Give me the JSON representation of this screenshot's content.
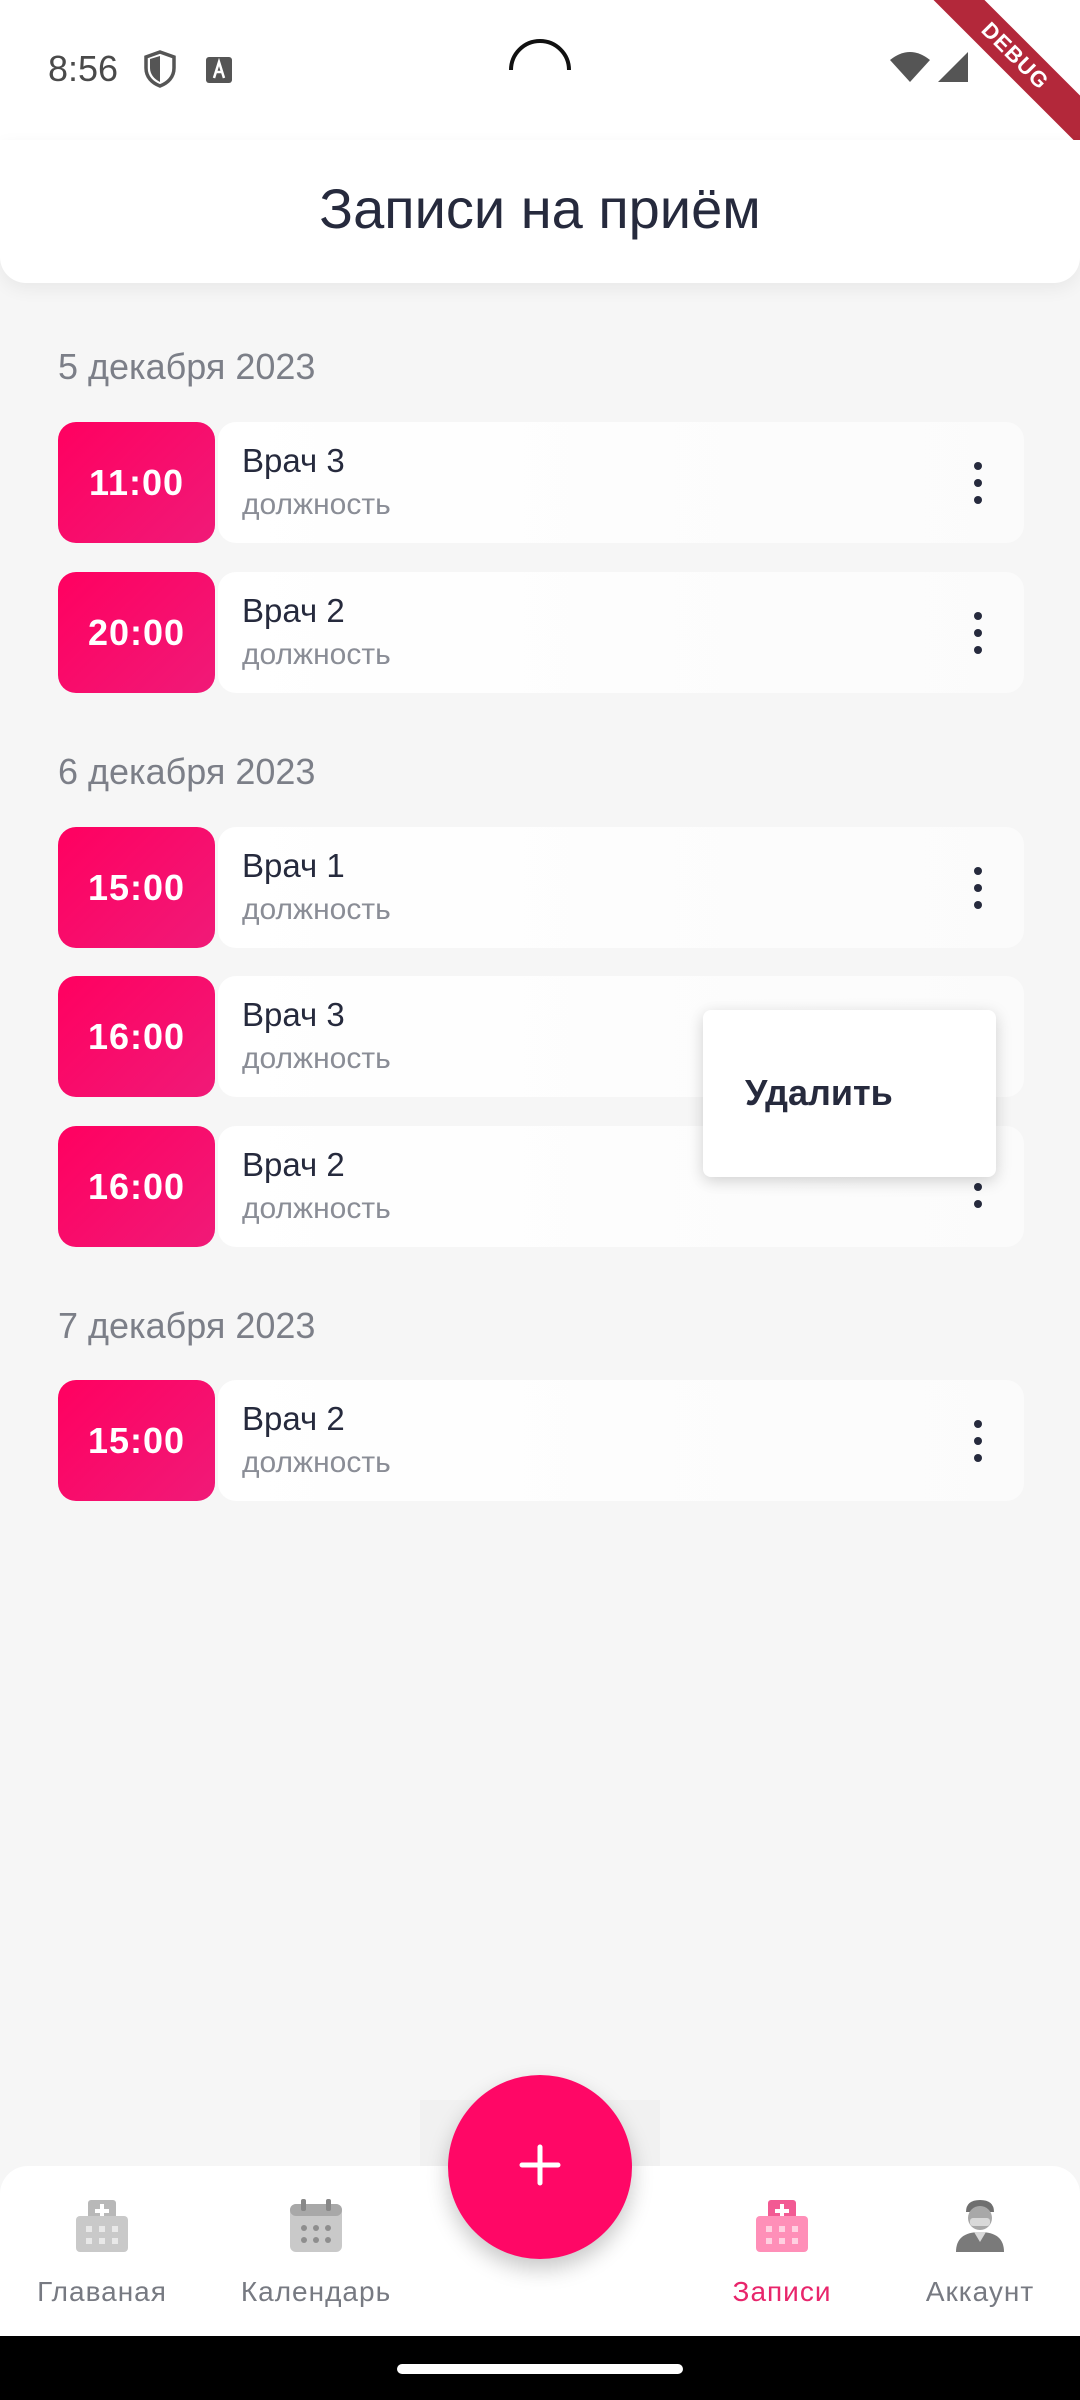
{
  "status_bar": {
    "time": "8:56",
    "debug_label": "DEBUG"
  },
  "header": {
    "title": "Записи на приём"
  },
  "days": [
    {
      "date": "5 декабря 2023",
      "appointments": [
        {
          "time": "11:00",
          "doctor": "Врач 3",
          "role": "должность"
        },
        {
          "time": "20:00",
          "doctor": "Врач 2",
          "role": "должность"
        }
      ]
    },
    {
      "date": "6 декабря 2023",
      "appointments": [
        {
          "time": "15:00",
          "doctor": "Врач 1",
          "role": "должность"
        },
        {
          "time": "16:00",
          "doctor": "Врач 3",
          "role": "должность"
        },
        {
          "time": "16:00",
          "doctor": "Врач 2",
          "role": "должность"
        }
      ]
    },
    {
      "date": "7 декабря 2023",
      "appointments": [
        {
          "time": "15:00",
          "doctor": "Врач 2",
          "role": "должность"
        }
      ]
    }
  ],
  "popup_menu": {
    "delete_label": "Удалить"
  },
  "fab": {
    "icon": "plus-icon"
  },
  "bottom_nav": {
    "items": [
      {
        "label": "Главаная",
        "icon": "hospital-icon",
        "active": false
      },
      {
        "label": "Календарь",
        "icon": "calendar-icon",
        "active": false
      },
      {
        "label": "Записи",
        "icon": "hospital-icon",
        "active": true
      },
      {
        "label": "Аккаунт",
        "icon": "doctor-icon",
        "active": false
      }
    ]
  },
  "colors": {
    "accent": "#ff0766",
    "badge_gradient_start": "#ff0060",
    "badge_gradient_end": "#f01a78",
    "active_nav": "#e8256b",
    "text_primary": "#262a3d",
    "text_secondary": "#8a8d96",
    "background": "#f6f6f6"
  }
}
